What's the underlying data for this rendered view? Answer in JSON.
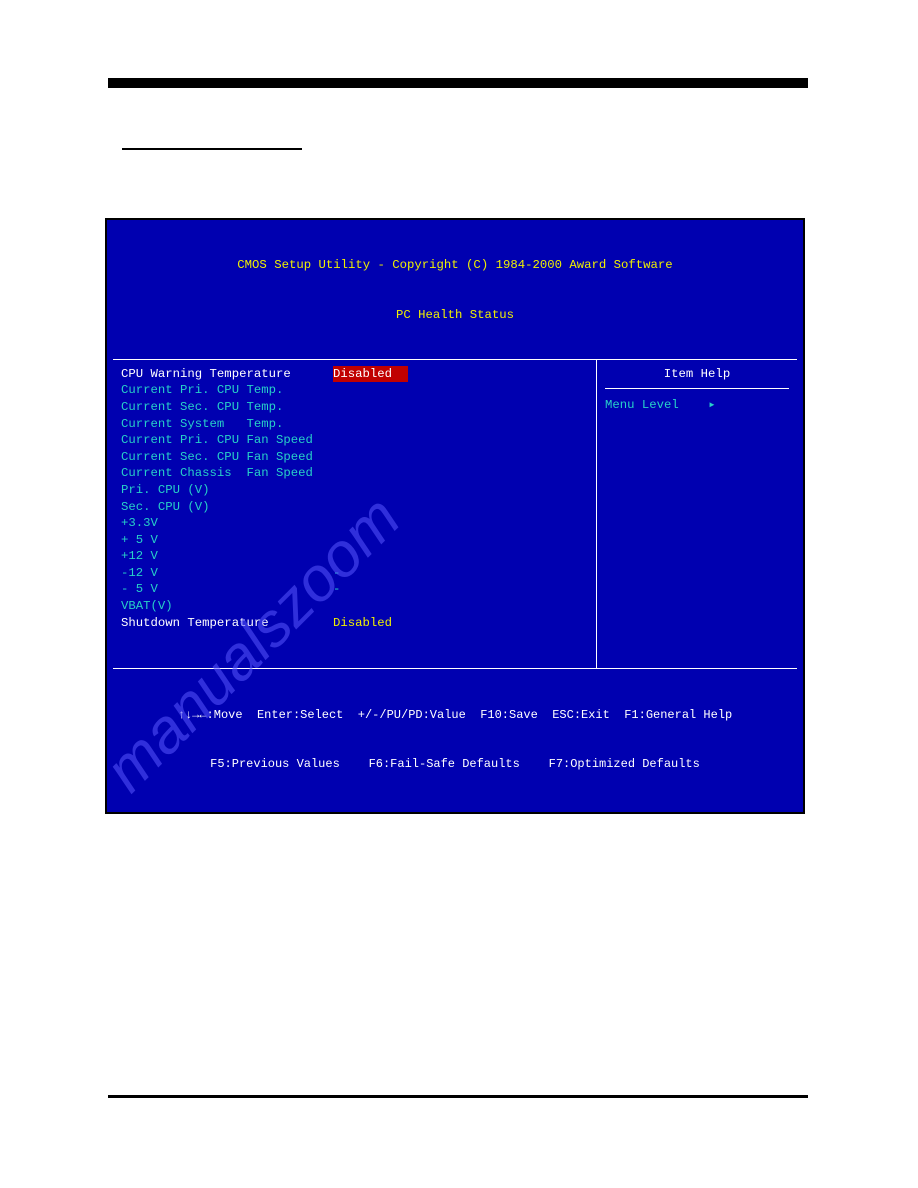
{
  "header": {
    "line1": "CMOS Setup Utility - Copyright (C) 1984-2000 Award Software",
    "line2": "PC Health Status"
  },
  "left_panel": {
    "rows": [
      {
        "label": "CPU Warning Temperature",
        "value": "Disabled",
        "label_cls": "white",
        "value_cls": "hl-red"
      },
      {
        "label": "Current Pri. CPU Temp.",
        "value": "",
        "label_cls": "teal",
        "value_cls": "teal"
      },
      {
        "label": "Current Sec. CPU Temp.",
        "value": "",
        "label_cls": "teal",
        "value_cls": "teal"
      },
      {
        "label": "Current System   Temp.",
        "value": "",
        "label_cls": "teal",
        "value_cls": "teal"
      },
      {
        "label": "Current Pri. CPU Fan Speed",
        "value": "",
        "label_cls": "teal",
        "value_cls": "teal"
      },
      {
        "label": "Current Sec. CPU Fan Speed",
        "value": "",
        "label_cls": "teal",
        "value_cls": "teal"
      },
      {
        "label": "Current Chassis  Fan Speed",
        "value": "",
        "label_cls": "teal",
        "value_cls": "teal"
      },
      {
        "label": "Pri. CPU (V)",
        "value": "",
        "label_cls": "teal",
        "value_cls": "teal"
      },
      {
        "label": "Sec. CPU (V)",
        "value": "",
        "label_cls": "teal",
        "value_cls": "teal"
      },
      {
        "label": "+3.3V",
        "value": "",
        "label_cls": "teal",
        "value_cls": "teal"
      },
      {
        "label": "+ 5 V",
        "value": "",
        "label_cls": "teal",
        "value_cls": "teal"
      },
      {
        "label": "+12 V",
        "value": "",
        "label_cls": "teal",
        "value_cls": "teal"
      },
      {
        "label": "-12 V",
        "value": "-",
        "label_cls": "teal",
        "value_cls": "teal"
      },
      {
        "label": "- 5 V",
        "value": "-",
        "label_cls": "teal",
        "value_cls": "teal"
      },
      {
        "label": "VBAT(V)",
        "value": "",
        "label_cls": "teal",
        "value_cls": "teal"
      },
      {
        "label": "Shutdown Temperature",
        "value": "Disabled",
        "label_cls": "white",
        "value_cls": "yellow"
      }
    ]
  },
  "right_panel": {
    "title": "Item Help",
    "menu_level": "Menu Level    ▸"
  },
  "footer": {
    "line1": "↑↓→←:Move  Enter:Select  +/-/PU/PD:Value  F10:Save  ESC:Exit  F1:General Help",
    "line2": "F5:Previous Values    F6:Fail-Safe Defaults    F7:Optimized Defaults"
  },
  "watermark": "manualszoom"
}
